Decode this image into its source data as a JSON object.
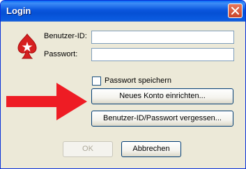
{
  "window": {
    "title": "Login"
  },
  "form": {
    "user_label": "Benutzer-ID:",
    "user_value": "",
    "password_label": "Passwort:",
    "password_value": ""
  },
  "remember": {
    "label": "Passwort speichern",
    "checked": false
  },
  "buttons": {
    "new_account": "Neues Konto einrichten...",
    "forgot": "Benutzer-ID/Passwort vergessen...",
    "ok": "OK",
    "cancel": "Abbrechen"
  },
  "colors": {
    "logo_red": "#d62020",
    "arrow_red": "#ee1c24",
    "titlebar_blue": "#0a55dd"
  },
  "icons": {
    "logo": "spade-star-logo",
    "close": "close-icon",
    "arrow": "red-arrow-annotation"
  }
}
